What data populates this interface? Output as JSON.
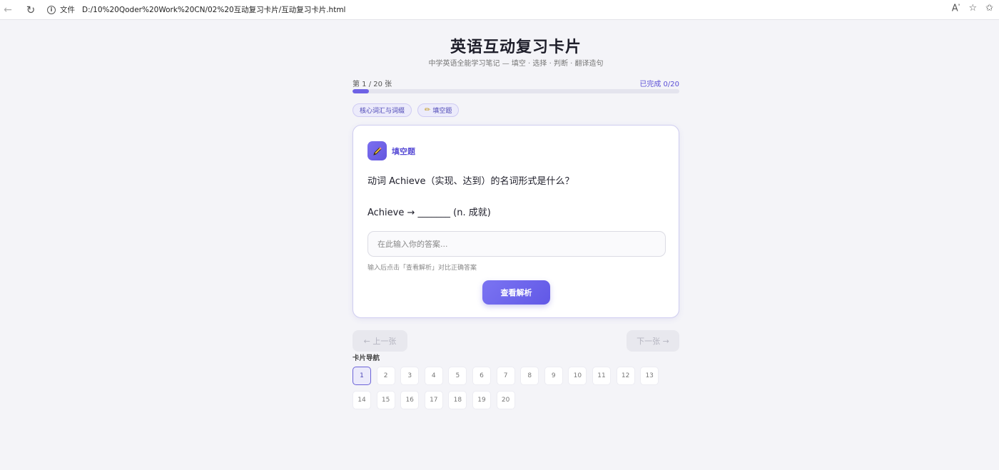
{
  "browser": {
    "file_label": "文件",
    "url": "D:/10%20Qoder%20Work%20CN/02%20互动复习卡片/互动复习卡片.html"
  },
  "header": {
    "title": "英语互动复习卡片",
    "subtitle": "中学英语全能学习笔记 — 填空 · 选择 · 判断 · 翻译造句"
  },
  "progress": {
    "position_text": "第 1 / 20 张",
    "completed_text": "已完成 0/20",
    "fraction": 0.05
  },
  "tags": {
    "category": "核心词汇与词缀",
    "type": "填空题"
  },
  "card": {
    "type_label": "填空题",
    "question": "动词 Achieve（实现、达到）的名词形式是什么？",
    "prompt": "Achieve → _______ (n. 成就)",
    "input_placeholder": "在此输入你的答案...",
    "input_value": "",
    "hint": "输入后点击「查看解析」对比正确答案",
    "analysis_button": "查看解析"
  },
  "navigation": {
    "prev_label": "← 上一张",
    "next_label": "下一张 →"
  },
  "navigator": {
    "title": "卡片导航",
    "current": 1,
    "cards": [
      "1",
      "2",
      "3",
      "4",
      "5",
      "6",
      "7",
      "8",
      "9",
      "10",
      "11",
      "12",
      "13",
      "14",
      "15",
      "16",
      "17",
      "18",
      "19",
      "20"
    ]
  },
  "colors": {
    "accent": "#6e62e5",
    "background": "#f4f4f8"
  }
}
